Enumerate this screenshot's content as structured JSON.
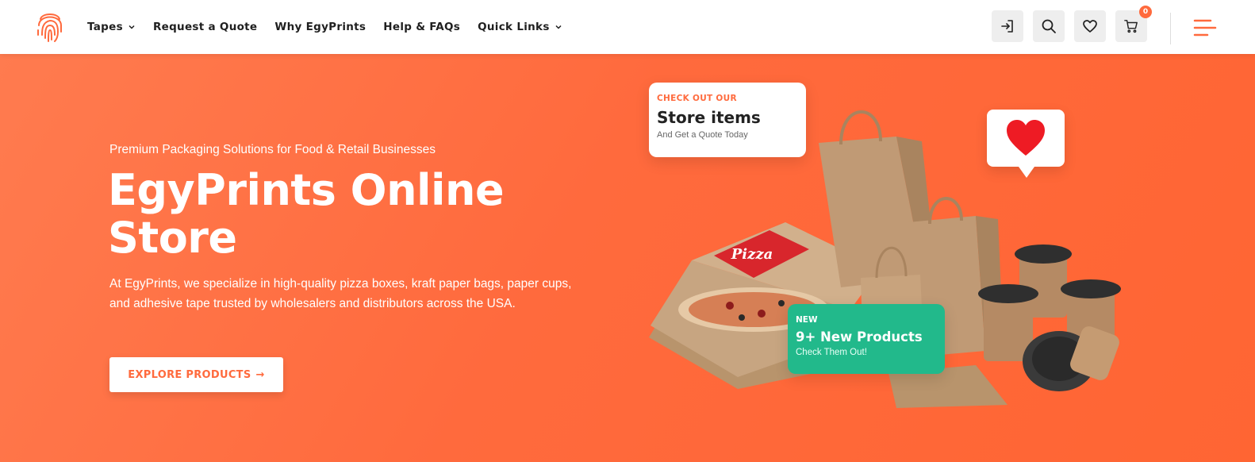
{
  "nav": {
    "logo_icon": "fingerprint-logo-icon",
    "items": [
      {
        "label": "Tapes",
        "has_dropdown": true
      },
      {
        "label": "Request a Quote",
        "has_dropdown": false
      },
      {
        "label": "Why EgyPrints",
        "has_dropdown": false
      },
      {
        "label": "Help & FAQs",
        "has_dropdown": false
      },
      {
        "label": "Quick Links",
        "has_dropdown": true
      }
    ],
    "actions": {
      "login_icon": "login-icon",
      "search_icon": "search-icon",
      "wishlist_icon": "heart-icon",
      "cart_icon": "cart-icon",
      "cart_count": "0"
    }
  },
  "hero": {
    "subtitle": "Premium Packaging Solutions for Food & Retail Businesses",
    "title": "EgyPrints Online Store",
    "description": "At EgyPrints, we specialize in high-quality pizza boxes, kraft paper bags, paper cups, and adhesive tape trusted by wholesalers and distributors across the USA.",
    "cta_label": "EXPLORE PRODUCTS",
    "cta_arrow": "→"
  },
  "cards": {
    "store": {
      "kicker": "CHECK OUT OUR",
      "heading": "Store items",
      "sub": "And Get a Quote Today"
    },
    "new": {
      "kicker": "NEW",
      "heading": "9+ New Products",
      "sub": "Check Them Out!"
    }
  },
  "illustration": {
    "pizza_label": "Pizza"
  },
  "colors": {
    "accent": "#ff6a3d",
    "green": "#22b98b",
    "kraft": "#c7a581"
  }
}
